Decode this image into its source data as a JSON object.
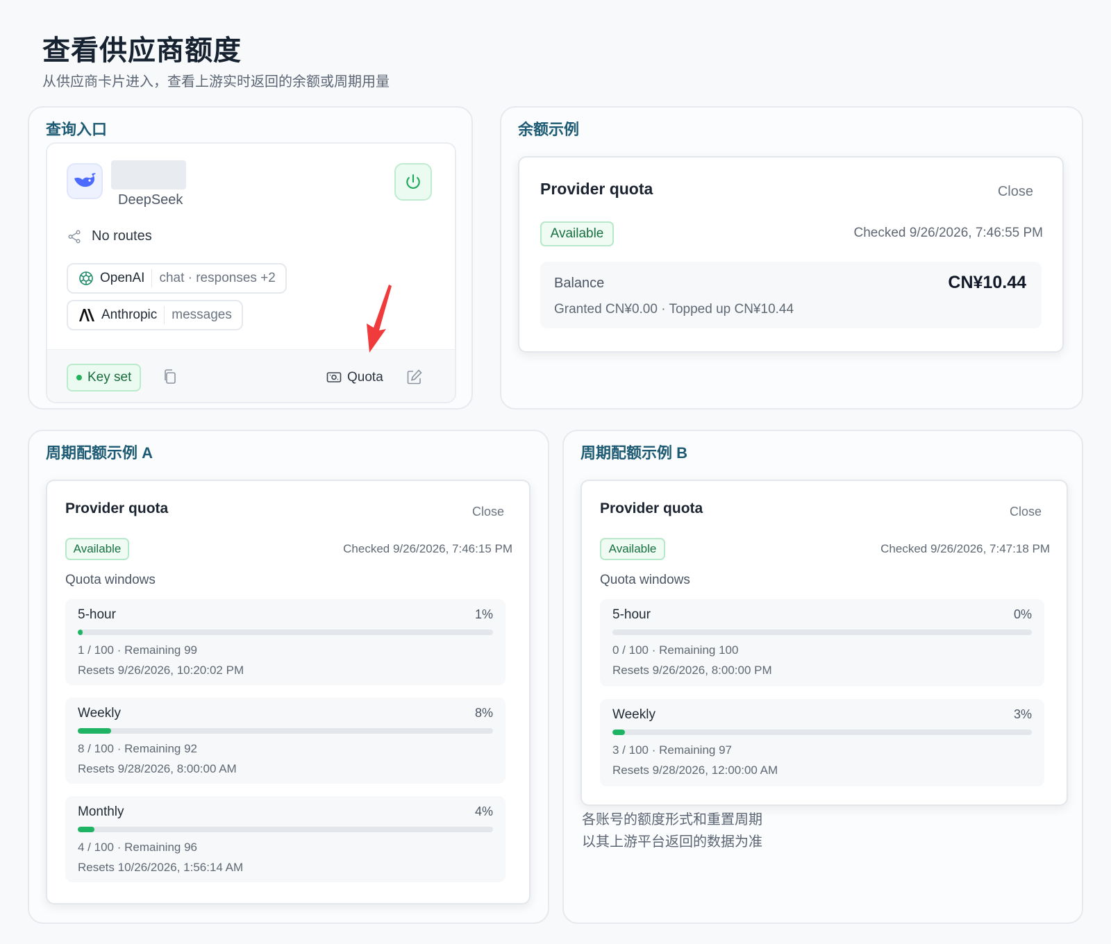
{
  "header": {
    "title": "查看供应商额度",
    "subtitle": "从供应商卡片进入，查看上游实时返回的余额或周期用量"
  },
  "entry_panel": {
    "title": "查询入口",
    "provider": {
      "name": "DeepSeek",
      "routes_text": "No routes",
      "chips": [
        {
          "brand": "OpenAI",
          "capabilities": "chat · responses +2"
        },
        {
          "brand": "Anthropic",
          "capabilities": "messages"
        }
      ],
      "key_status": "Key set",
      "quota_label": "Quota",
      "status_color": "#22b35b",
      "logo_color": "#4d6bfe"
    }
  },
  "balance_panel": {
    "title": "余额示例",
    "dialog": {
      "title": "Provider quota",
      "close_label": "Close",
      "status": "Available",
      "checked": "Checked 9/26/2026, 7:46:55 PM",
      "balance_label": "Balance",
      "balance_value": "CN¥10.44",
      "balance_detail": "Granted CN¥0.00 · Topped up CN¥10.44"
    }
  },
  "cycle_a": {
    "title": "周期配额示例 A",
    "dialog": {
      "title": "Provider quota",
      "close_label": "Close",
      "status": "Available",
      "checked": "Checked 9/26/2026, 7:46:15 PM",
      "windows_label": "Quota windows",
      "windows": [
        {
          "name": "5-hour",
          "percent_label": "1%",
          "percent": 1,
          "usage": "1 / 100 · Remaining 99",
          "reset": "Resets 9/26/2026, 10:20:02 PM"
        },
        {
          "name": "Weekly",
          "percent_label": "8%",
          "percent": 8,
          "usage": "8 / 100 · Remaining 92",
          "reset": "Resets 9/28/2026, 8:00:00 AM"
        },
        {
          "name": "Monthly",
          "percent_label": "4%",
          "percent": 4,
          "usage": "4 / 100 · Remaining 96",
          "reset": "Resets 10/26/2026, 1:56:14 AM"
        }
      ]
    }
  },
  "cycle_b": {
    "title": "周期配额示例 B",
    "dialog": {
      "title": "Provider quota",
      "close_label": "Close",
      "status": "Available",
      "checked": "Checked 9/26/2026, 7:47:18 PM",
      "windows_label": "Quota windows",
      "windows": [
        {
          "name": "5-hour",
          "percent_label": "0%",
          "percent": 0,
          "usage": "0 / 100 · Remaining 100",
          "reset": "Resets 9/26/2026, 8:00:00 PM"
        },
        {
          "name": "Weekly",
          "percent_label": "3%",
          "percent": 3,
          "usage": "3 / 100 · Remaining 97",
          "reset": "Resets 9/28/2026, 12:00:00 AM"
        }
      ]
    },
    "note_lines": [
      "各账号的额度形式和重置周期",
      "以其上游平台返回的数据为准"
    ]
  }
}
